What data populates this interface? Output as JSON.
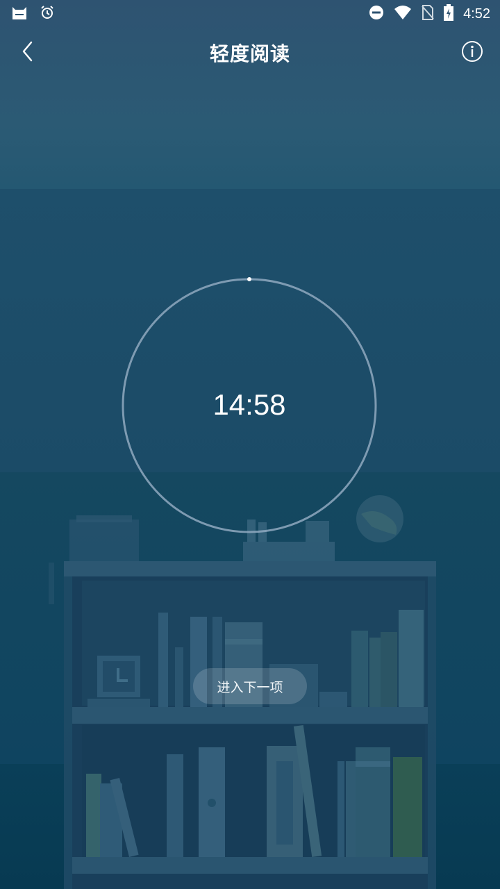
{
  "status_bar": {
    "time": "4:52",
    "left_icons": [
      "cat-app-icon",
      "alarm-icon"
    ],
    "right_icons": [
      "do-not-disturb-icon",
      "wifi-icon",
      "no-sim-icon",
      "battery-charging-icon"
    ]
  },
  "app_bar": {
    "title": "轻度阅读",
    "back_icon": "chevron-left-icon",
    "info_icon": "info-icon"
  },
  "timer": {
    "display": "14:58",
    "progress": 0.0
  },
  "actions": {
    "next_label": "进入下一项"
  }
}
